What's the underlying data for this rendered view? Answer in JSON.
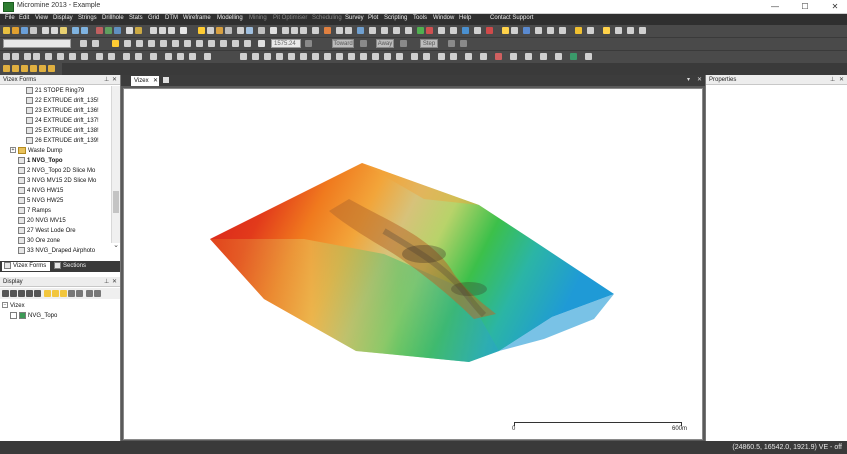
{
  "window": {
    "title": "Micromine 2013 - Example",
    "min": "—",
    "max": "☐",
    "close": "✕"
  },
  "menu": [
    {
      "label": "File",
      "enabled": true
    },
    {
      "label": "Edit",
      "enabled": true
    },
    {
      "label": "View",
      "enabled": true
    },
    {
      "label": "Display",
      "enabled": true
    },
    {
      "label": "Strings",
      "enabled": true
    },
    {
      "label": "Drillhole",
      "enabled": true
    },
    {
      "label": "Stats",
      "enabled": true
    },
    {
      "label": "Grid",
      "enabled": true
    },
    {
      "label": "DTM",
      "enabled": true
    },
    {
      "label": "Wireframe",
      "enabled": true
    },
    {
      "label": "Modelling",
      "enabled": true
    },
    {
      "label": "Mining",
      "enabled": false
    },
    {
      "label": "Pit Optimiser",
      "enabled": false
    },
    {
      "label": "Scheduling",
      "enabled": false
    },
    {
      "label": "Survey",
      "enabled": true
    },
    {
      "label": "Plot",
      "enabled": true
    },
    {
      "label": "Scripting",
      "enabled": true
    },
    {
      "label": "Tools",
      "enabled": true
    },
    {
      "label": "Window",
      "enabled": true
    },
    {
      "label": "Help",
      "enabled": true
    },
    {
      "label": "Contact Support",
      "enabled": true
    }
  ],
  "toolbar": {
    "value_field": "1575.24",
    "toward_label": "Toward",
    "away_label": "Away",
    "step_label": "Step"
  },
  "vizex_forms": {
    "title": "Vizex Forms",
    "pin": "⊥",
    "close": "✕",
    "items": [
      {
        "label": "21 STOPE Ring79",
        "type": "form",
        "indent": 2,
        "bold": false
      },
      {
        "label": "22 EXTRUDE drift_135!",
        "type": "form",
        "indent": 2,
        "bold": false
      },
      {
        "label": "23 EXTRUDE drift_136!",
        "type": "form",
        "indent": 2,
        "bold": false
      },
      {
        "label": "24 EXTRUDE drift_137!",
        "type": "form",
        "indent": 2,
        "bold": false
      },
      {
        "label": "25 EXTRUDE drift_138!",
        "type": "form",
        "indent": 2,
        "bold": false
      },
      {
        "label": "26 EXTRUDE drift_139!",
        "type": "form",
        "indent": 2,
        "bold": false
      },
      {
        "label": "Waste Dump",
        "type": "folder",
        "indent": 1,
        "bold": false
      },
      {
        "label": "1 NVG_Topo",
        "type": "form",
        "indent": 1,
        "bold": true
      },
      {
        "label": "2 NVG_Topo 2D Slice Mo",
        "type": "form",
        "indent": 1,
        "bold": false
      },
      {
        "label": "3 NVG MV15 2D Slice Mo",
        "type": "form",
        "indent": 1,
        "bold": false
      },
      {
        "label": "4 NVG HW15",
        "type": "form",
        "indent": 1,
        "bold": false
      },
      {
        "label": "5 NVG HW25",
        "type": "form",
        "indent": 1,
        "bold": false
      },
      {
        "label": "7 Ramps",
        "type": "form",
        "indent": 1,
        "bold": false
      },
      {
        "label": "20 NVG MV15",
        "type": "form",
        "indent": 1,
        "bold": false
      },
      {
        "label": "27 West Lode Ore",
        "type": "form",
        "indent": 1,
        "bold": false
      },
      {
        "label": "30 Ore zone",
        "type": "form",
        "indent": 1,
        "bold": false
      },
      {
        "label": "33 NVG_Draped Airphoto",
        "type": "form",
        "indent": 1,
        "bold": false
      }
    ],
    "scroll_down": "⌄"
  },
  "bottom_tabs": [
    {
      "label": "Vizex Forms",
      "active": true
    },
    {
      "label": "Sections",
      "active": false
    }
  ],
  "display_panel": {
    "title": "Display",
    "pin": "⊥",
    "close": "✕",
    "root": "Vizex",
    "layers": [
      {
        "label": "NVG_Topo",
        "checked": true
      }
    ]
  },
  "viewport": {
    "tab_label": "Vizex",
    "tab_close": "✕",
    "tab_pin": "▾",
    "panel_close": "✕",
    "scalebar": {
      "start_label": "0",
      "end_label": "600m"
    }
  },
  "properties": {
    "title": "Properties",
    "pin": "⊥",
    "close": "✕"
  },
  "status": {
    "coordinates": "(24860.5, 16542.0, 1921.9)  VE - off"
  },
  "colors": {
    "menu_bg": "#2f2f2f",
    "toolbar_bg": "#4a4a4a",
    "panel_bg": "#ffffff",
    "dtm_low": "#1f9ad6",
    "dtm_mid": "#3cc04a",
    "dtm_high": "#d71c1c"
  }
}
